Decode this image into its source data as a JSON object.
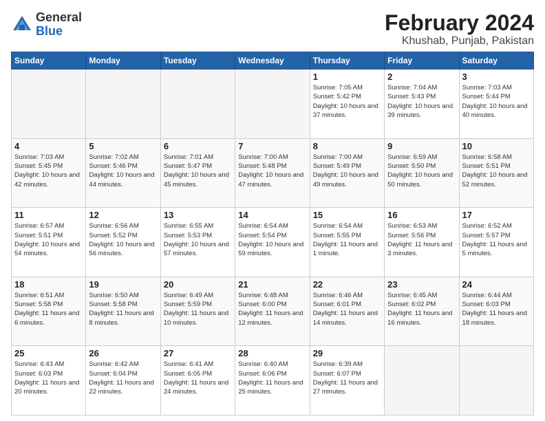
{
  "logo": {
    "text_general": "General",
    "text_blue": "Blue"
  },
  "header": {
    "month_year": "February 2024",
    "location": "Khushab, Punjab, Pakistan"
  },
  "weekdays": [
    "Sunday",
    "Monday",
    "Tuesday",
    "Wednesday",
    "Thursday",
    "Friday",
    "Saturday"
  ],
  "weeks": [
    [
      {
        "day": "",
        "empty": true
      },
      {
        "day": "",
        "empty": true
      },
      {
        "day": "",
        "empty": true
      },
      {
        "day": "",
        "empty": true
      },
      {
        "day": "1",
        "sunrise": "7:05 AM",
        "sunset": "5:42 PM",
        "daylight": "10 hours and 37 minutes."
      },
      {
        "day": "2",
        "sunrise": "7:04 AM",
        "sunset": "5:43 PM",
        "daylight": "10 hours and 39 minutes."
      },
      {
        "day": "3",
        "sunrise": "7:03 AM",
        "sunset": "5:44 PM",
        "daylight": "10 hours and 40 minutes."
      }
    ],
    [
      {
        "day": "4",
        "sunrise": "7:03 AM",
        "sunset": "5:45 PM",
        "daylight": "10 hours and 42 minutes."
      },
      {
        "day": "5",
        "sunrise": "7:02 AM",
        "sunset": "5:46 PM",
        "daylight": "10 hours and 44 minutes."
      },
      {
        "day": "6",
        "sunrise": "7:01 AM",
        "sunset": "5:47 PM",
        "daylight": "10 hours and 45 minutes."
      },
      {
        "day": "7",
        "sunrise": "7:00 AM",
        "sunset": "5:48 PM",
        "daylight": "10 hours and 47 minutes."
      },
      {
        "day": "8",
        "sunrise": "7:00 AM",
        "sunset": "5:49 PM",
        "daylight": "10 hours and 49 minutes."
      },
      {
        "day": "9",
        "sunrise": "6:59 AM",
        "sunset": "5:50 PM",
        "daylight": "10 hours and 50 minutes."
      },
      {
        "day": "10",
        "sunrise": "6:58 AM",
        "sunset": "5:51 PM",
        "daylight": "10 hours and 52 minutes."
      }
    ],
    [
      {
        "day": "11",
        "sunrise": "6:57 AM",
        "sunset": "5:51 PM",
        "daylight": "10 hours and 54 minutes."
      },
      {
        "day": "12",
        "sunrise": "6:56 AM",
        "sunset": "5:52 PM",
        "daylight": "10 hours and 56 minutes."
      },
      {
        "day": "13",
        "sunrise": "6:55 AM",
        "sunset": "5:53 PM",
        "daylight": "10 hours and 57 minutes."
      },
      {
        "day": "14",
        "sunrise": "6:54 AM",
        "sunset": "5:54 PM",
        "daylight": "10 hours and 59 minutes."
      },
      {
        "day": "15",
        "sunrise": "6:54 AM",
        "sunset": "5:55 PM",
        "daylight": "11 hours and 1 minute."
      },
      {
        "day": "16",
        "sunrise": "6:53 AM",
        "sunset": "5:56 PM",
        "daylight": "11 hours and 3 minutes."
      },
      {
        "day": "17",
        "sunrise": "6:52 AM",
        "sunset": "5:57 PM",
        "daylight": "11 hours and 5 minutes."
      }
    ],
    [
      {
        "day": "18",
        "sunrise": "6:51 AM",
        "sunset": "5:58 PM",
        "daylight": "11 hours and 6 minutes."
      },
      {
        "day": "19",
        "sunrise": "6:50 AM",
        "sunset": "5:58 PM",
        "daylight": "11 hours and 8 minutes."
      },
      {
        "day": "20",
        "sunrise": "6:49 AM",
        "sunset": "5:59 PM",
        "daylight": "11 hours and 10 minutes."
      },
      {
        "day": "21",
        "sunrise": "6:48 AM",
        "sunset": "6:00 PM",
        "daylight": "11 hours and 12 minutes."
      },
      {
        "day": "22",
        "sunrise": "6:46 AM",
        "sunset": "6:01 PM",
        "daylight": "11 hours and 14 minutes."
      },
      {
        "day": "23",
        "sunrise": "6:45 AM",
        "sunset": "6:02 PM",
        "daylight": "11 hours and 16 minutes."
      },
      {
        "day": "24",
        "sunrise": "6:44 AM",
        "sunset": "6:03 PM",
        "daylight": "11 hours and 18 minutes."
      }
    ],
    [
      {
        "day": "25",
        "sunrise": "6:43 AM",
        "sunset": "6:03 PM",
        "daylight": "11 hours and 20 minutes."
      },
      {
        "day": "26",
        "sunrise": "6:42 AM",
        "sunset": "6:04 PM",
        "daylight": "11 hours and 22 minutes."
      },
      {
        "day": "27",
        "sunrise": "6:41 AM",
        "sunset": "6:05 PM",
        "daylight": "11 hours and 24 minutes."
      },
      {
        "day": "28",
        "sunrise": "6:40 AM",
        "sunset": "6:06 PM",
        "daylight": "11 hours and 25 minutes."
      },
      {
        "day": "29",
        "sunrise": "6:39 AM",
        "sunset": "6:07 PM",
        "daylight": "11 hours and 27 minutes."
      },
      {
        "day": "",
        "empty": true
      },
      {
        "day": "",
        "empty": true
      }
    ]
  ],
  "labels": {
    "sunrise": "Sunrise:",
    "sunset": "Sunset:",
    "daylight": "Daylight:"
  }
}
